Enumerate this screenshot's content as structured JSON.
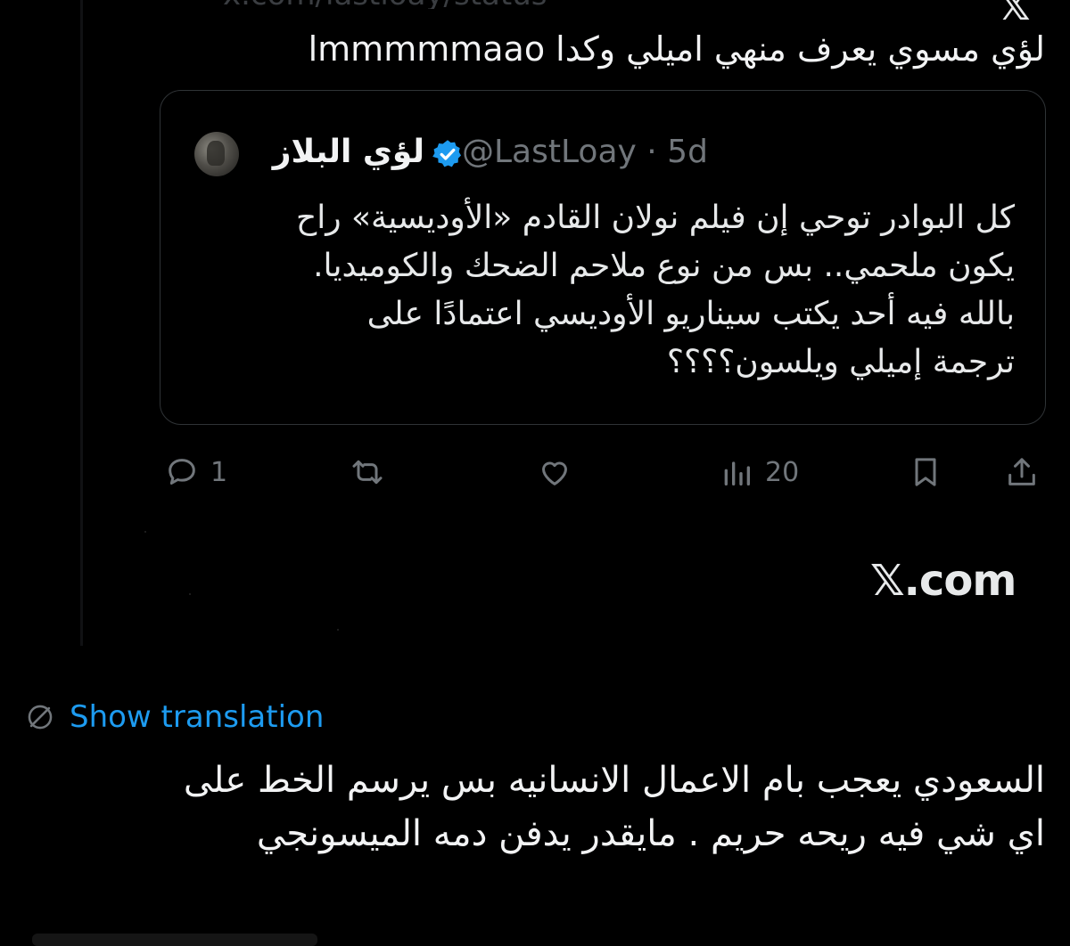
{
  "top_partial": {
    "text": "x.com — partial link text cut off at top edge",
    "x_logo": "𝕏"
  },
  "post": {
    "text": "لؤي مسوي يعرف منهي اميلي وكدا lmmmmmaao"
  },
  "quote": {
    "author_name": "لؤي البلاز",
    "handle": "@LastLoay",
    "separator": "·",
    "time": "5d",
    "body_lines": [
      "كل البوادر توحي إن فيلم نولان القادم «الأوديسية» راح",
      "يكون ملحمي.. بس من نوع ملاحم الضحك والكوميديا.",
      "بالله فيه أحد يكتب سيناريو الأوديسي اعتمادًا على",
      "ترجمة إميلي ويلسون؟؟؟؟"
    ]
  },
  "actions": {
    "reply_count": "1",
    "repost_count": "",
    "like_count": "",
    "views_count": "20"
  },
  "watermark": {
    "text": "𝕏.com"
  },
  "translation": {
    "label": "Show translation",
    "icon": "translate-globe-icon"
  },
  "reply": {
    "lines": [
      "السعودي يعجب بام الاعمال الانسانيه بس يرسم الخط على",
      "اي شي فيه ريحه حريم . مايقدر يدفن دمه الميسونجي"
    ]
  },
  "colors": {
    "background": "#000000",
    "text": "#e7e9ea",
    "muted": "#71767b",
    "link": "#1d9bf0",
    "verified": "#1d9bf0",
    "border": "#2f3336"
  }
}
